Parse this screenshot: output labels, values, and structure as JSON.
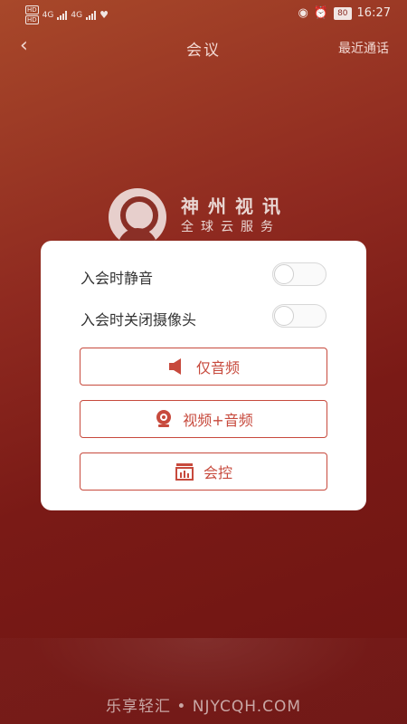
{
  "statusbar": {
    "hd1": "HD",
    "hd2": "HD",
    "net1": "4G",
    "net2": "4G",
    "battery": "80",
    "time": "16:27"
  },
  "topbar": {
    "title": "会议",
    "recent_calls": "最近通话"
  },
  "brand": {
    "name": "神州视讯",
    "tagline": "全球云服务"
  },
  "dialog": {
    "toggles": [
      {
        "label": "入会时静音",
        "checked": false
      },
      {
        "label": "入会时关闭摄像头",
        "checked": false
      }
    ],
    "buttons": {
      "audio_only": "仅音频",
      "video_audio": "视频+音频",
      "control": "会控"
    }
  },
  "colors": {
    "accent": "#c74a3d",
    "background_top": "#a8482a",
    "background_bottom": "#6e1412"
  },
  "watermark": "乐享轻汇 • NJYCQH.COM"
}
